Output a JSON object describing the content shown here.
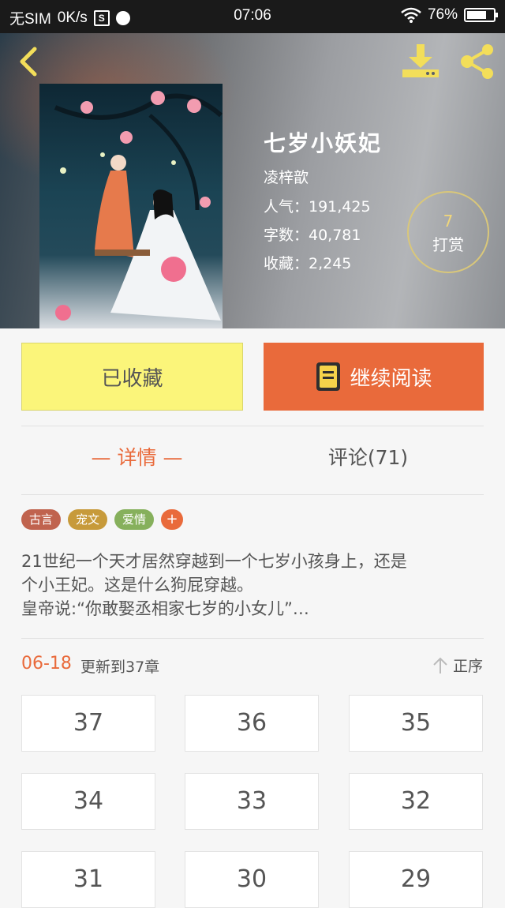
{
  "status_bar": {
    "carrier": "无SIM",
    "speed": "0K/s",
    "sim_icon": "S",
    "time": "07:06",
    "battery": "76%",
    "battery_level": 0.76
  },
  "header": {
    "back_icon": "chevron-left-icon",
    "download_icon": "download-icon",
    "share_icon": "share-icon"
  },
  "book": {
    "title": "七岁小妖妃",
    "author": "凌梓歆",
    "popularity": "人气：191,425",
    "word_count": "字数：40,781",
    "favorites": "收藏：2,245",
    "reward_count": "7",
    "reward_label": "打赏"
  },
  "actions": {
    "collected_label": "已收藏",
    "continue_label": "继续阅读"
  },
  "tabs": {
    "detail": "— 详情 —",
    "comments": "评论(71)"
  },
  "tags": [
    {
      "label": "古言",
      "color": "#c0634e"
    },
    {
      "label": "宠文",
      "color": "#c79a3a"
    },
    {
      "label": "爱情",
      "color": "#86b05c"
    }
  ],
  "tag_add": "+",
  "description": {
    "line1": "21世纪一个天才居然穿越到一个七岁小孩身上，还是",
    "line2": "个小王妃。这是什么狗屁穿越。",
    "line3": "皇帝说:“你敢娶丞相家七岁的小女儿”…"
  },
  "update": {
    "date": "06-18",
    "text": "更新到37章",
    "order_label": "正序"
  },
  "chapters": [
    "37",
    "36",
    "35",
    "34",
    "33",
    "32",
    "31",
    "30",
    "29"
  ],
  "colors": {
    "accent": "#e96a3b",
    "collected_bg": "#fbf57a"
  }
}
